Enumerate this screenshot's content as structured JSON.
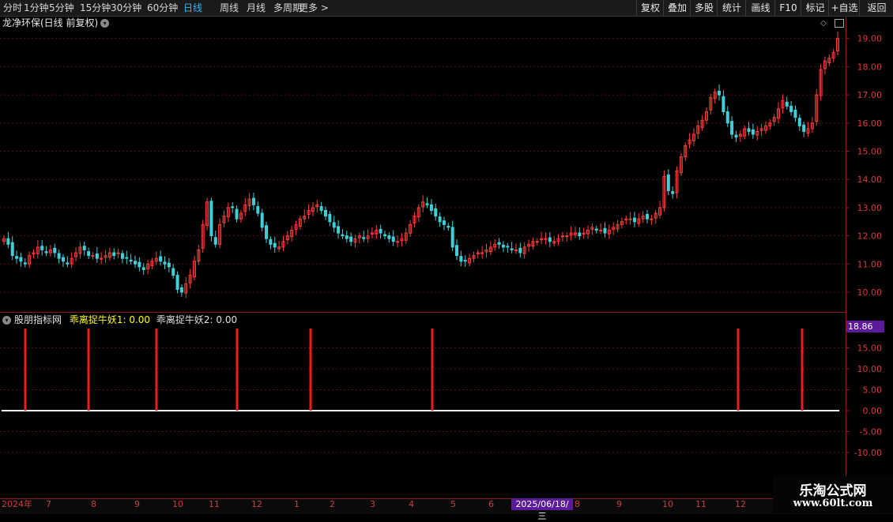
{
  "toolbar": {
    "periods": [
      "分时",
      "1分钟",
      "5分钟",
      "15分钟",
      "30分钟",
      "60分钟",
      "日线",
      "周线",
      "月线",
      "多周期",
      "更多 >"
    ],
    "active_period": "日线",
    "right_tools": [
      "复权",
      "叠加",
      "多股",
      "统计",
      "画线",
      "F10",
      "标记",
      "+自选",
      "返回"
    ]
  },
  "chart_title": "龙净环保(日线 前复权)",
  "indicator": {
    "name": "股朋指标网",
    "line1": "乖离捉牛妖1: 0.00",
    "line2": "乖离捉牛妖2: 0.00",
    "line1_color": "#ffff00",
    "line2_color": "#e0e0e0"
  },
  "price_axis_labels": [
    "19.00",
    "18.00",
    "17.00",
    "16.00",
    "15.00",
    "14.00",
    "13.00",
    "12.00",
    "11.00",
    "10.00"
  ],
  "indicator_axis_labels": [
    "15.00",
    "10.00",
    "5.00",
    "0.00",
    "-5.00",
    "-10.00"
  ],
  "indicator_value_tag": "18.86",
  "x_axis_labels": [
    "2024年",
    "7",
    "8",
    "9",
    "10",
    "11",
    "12",
    "1",
    "2",
    "3",
    "4",
    "5",
    "6",
    "8",
    "9",
    "10",
    "11",
    "12"
  ],
  "cursor_date": "2025/06/18/三",
  "watermark": {
    "line1": "乐淘公式网",
    "line2": "www.60lt.com"
  },
  "colors": {
    "up": "#ff3b3b",
    "down": "#3fd0d8",
    "signal": "#ee1c1c",
    "active": "#31b9ff"
  },
  "chart_data": {
    "type": "candlestick",
    "price_range": [
      9.7,
      19.5
    ],
    "close_series": [
      11.9,
      11.7,
      11.3,
      11.2,
      11.1,
      11.0,
      11.3,
      11.4,
      11.6,
      11.5,
      11.4,
      11.5,
      11.4,
      11.2,
      11.1,
      11.0,
      11.2,
      11.4,
      11.6,
      11.5,
      11.3,
      11.3,
      11.2,
      11.2,
      11.3,
      11.4,
      11.3,
      11.4,
      11.2,
      11.2,
      11.1,
      11.0,
      10.9,
      10.8,
      11.0,
      11.1,
      11.2,
      11.1,
      11.0,
      10.9,
      10.6,
      10.1,
      10.0,
      10.3,
      10.6,
      11.1,
      11.5,
      12.4,
      13.2,
      12.0,
      11.7,
      12.4,
      12.7,
      13.0,
      13.0,
      12.6,
      12.8,
      13.1,
      13.3,
      13.1,
      12.8,
      12.3,
      11.9,
      11.7,
      11.6,
      11.6,
      11.8,
      12.0,
      12.2,
      12.4,
      12.6,
      12.7,
      12.9,
      13.0,
      13.1,
      12.9,
      12.7,
      12.5,
      12.3,
      12.1,
      12.0,
      11.9,
      11.8,
      11.9,
      12.0,
      11.9,
      12.0,
      12.1,
      12.2,
      12.1,
      12.0,
      11.9,
      11.8,
      11.8,
      11.9,
      12.1,
      12.4,
      12.7,
      13.0,
      13.2,
      13.1,
      12.9,
      12.7,
      12.5,
      12.4,
      12.3,
      11.6,
      11.3,
      11.1,
      11.1,
      11.2,
      11.3,
      11.4,
      11.4,
      11.5,
      11.6,
      11.7,
      11.7,
      11.6,
      11.6,
      11.5,
      11.5,
      11.4,
      11.6,
      11.7,
      11.8,
      11.8,
      11.9,
      11.9,
      11.8,
      11.8,
      11.9,
      12.0,
      12.0,
      12.1,
      12.1,
      12.0,
      12.1,
      12.2,
      12.3,
      12.2,
      12.2,
      12.1,
      12.2,
      12.3,
      12.4,
      12.5,
      12.6,
      12.6,
      12.5,
      12.6,
      12.7,
      12.6,
      12.6,
      12.8,
      13.0,
      14.1,
      13.6,
      13.5,
      14.3,
      14.8,
      15.2,
      15.4,
      15.6,
      15.9,
      16.1,
      16.4,
      16.9,
      17.1,
      17.0,
      16.4,
      16.0,
      15.6,
      15.5,
      15.6,
      15.8,
      15.7,
      15.6,
      15.7,
      15.8,
      15.9,
      16.0,
      16.2,
      16.5,
      16.8,
      16.6,
      16.4,
      16.2,
      15.9,
      15.7,
      15.8,
      16.0,
      17.0,
      17.9,
      18.2,
      18.3,
      18.5,
      19.0
    ]
  }
}
